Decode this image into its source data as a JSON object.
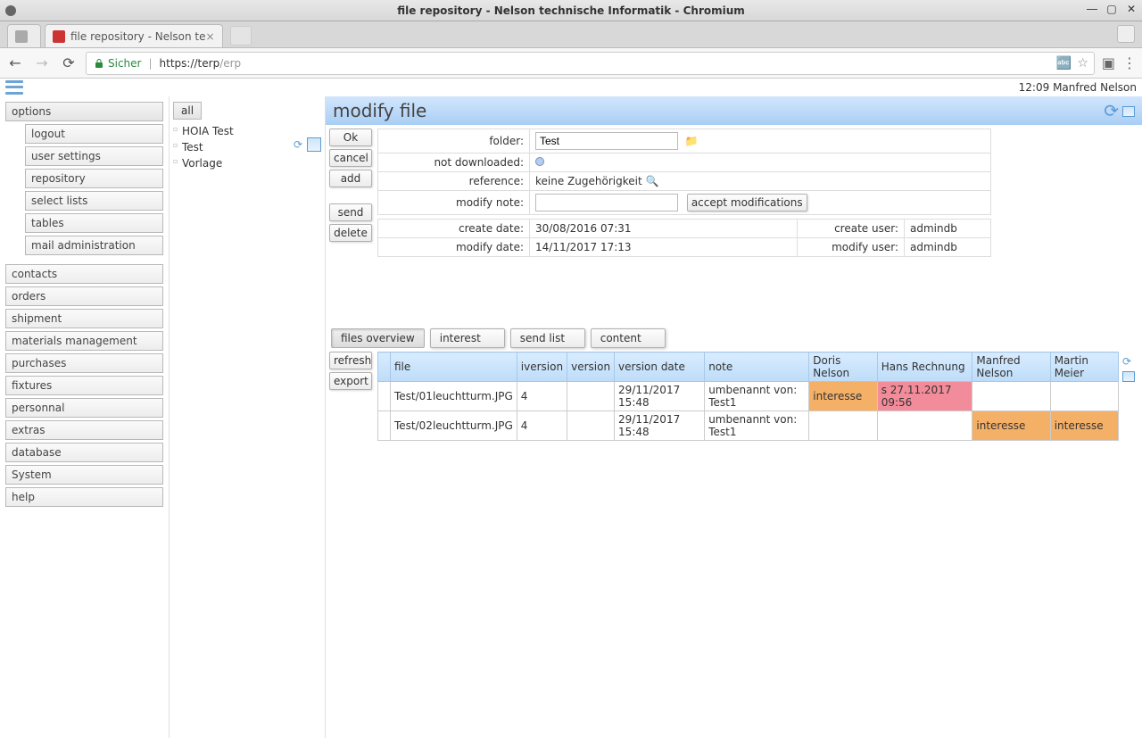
{
  "os": {
    "title": "file repository - Nelson technische Informatik - Chromium"
  },
  "browser": {
    "tabs": [
      {
        "title": ""
      },
      {
        "title": "file repository - Nelson te"
      }
    ],
    "secure_label": "Sicher",
    "url_prefix": "https://terp",
    "url_suffix": "/erp"
  },
  "header": {
    "time": "12:09",
    "user": "Manfred Nelson"
  },
  "sidebar": {
    "options_label": "options",
    "options_items": [
      "logout",
      "user settings",
      "repository",
      "select lists",
      "tables",
      "mail administration"
    ],
    "main_items": [
      "contacts",
      "orders",
      "shipment",
      "materials management",
      "purchases",
      "fixtures",
      "personnal",
      "extras",
      "database",
      "System",
      "help"
    ]
  },
  "tree": {
    "all_label": "all",
    "items": [
      "HOIA Test",
      "Test",
      "Vorlage"
    ]
  },
  "panel": {
    "title": "modify file",
    "actions1": [
      "Ok",
      "cancel",
      "add"
    ],
    "actions2": [
      "send",
      "delete"
    ],
    "folder_label": "folder:",
    "folder_value": "Test",
    "notdl_label": "not downloaded:",
    "reference_label": "reference:",
    "reference_value": "keine Zugehörigkeit",
    "note_label": "modify note:",
    "note_value": "",
    "accept_label": "accept modifications",
    "createdate_label": "create date:",
    "createdate_value": "30/08/2016 07:31",
    "createuser_label": "create user:",
    "createuser_value": "admindb",
    "modifydate_label": "modify date:",
    "modifydate_value": "14/11/2017 17:13",
    "modifyuser_label": "modify user:",
    "modifyuser_value": "admindb"
  },
  "tabs": {
    "items": [
      "files overview",
      "interest",
      "send list",
      "content"
    ],
    "active": 0
  },
  "grid": {
    "actions": [
      "refresh",
      "export"
    ],
    "headers": [
      "file",
      "iversion",
      "version",
      "version date",
      "note",
      "Doris Nelson",
      "Hans Rechnung",
      "Manfred Nelson",
      "Martin Meier"
    ],
    "rows": [
      {
        "file": "Test/01leuchtturm.JPG",
        "iversion": "4",
        "version": "",
        "vdate": "29/11/2017 15:48",
        "note": "umbenannt von: Test1",
        "c1": {
          "v": "interesse",
          "cls": "hl-orange"
        },
        "c2": {
          "v": "s 27.11.2017 09:56",
          "cls": "hl-pink"
        },
        "c3": {
          "v": "",
          "cls": ""
        },
        "c4": {
          "v": "",
          "cls": ""
        }
      },
      {
        "file": "Test/02leuchtturm.JPG",
        "iversion": "4",
        "version": "",
        "vdate": "29/11/2017 15:48",
        "note": "umbenannt von: Test1",
        "c1": {
          "v": "",
          "cls": ""
        },
        "c2": {
          "v": "",
          "cls": ""
        },
        "c3": {
          "v": "interesse",
          "cls": "hl-orange"
        },
        "c4": {
          "v": "interesse",
          "cls": "hl-orange"
        }
      }
    ]
  }
}
